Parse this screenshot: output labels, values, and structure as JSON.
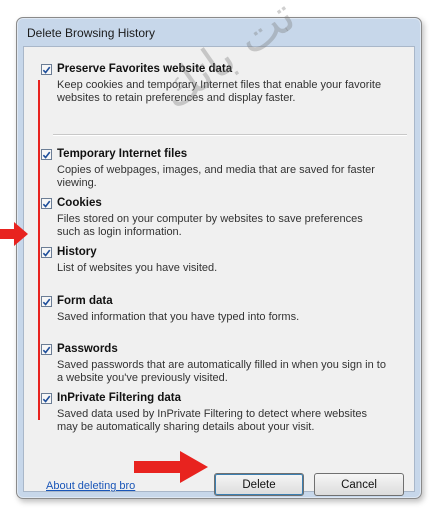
{
  "window": {
    "title": "Delete Browsing History"
  },
  "options": [
    {
      "key": "preserve",
      "label": "Preserve Favorites website data",
      "checked": true,
      "description": "Keep cookies and temporary Internet files that enable your favorite websites to retain preferences and display faster."
    },
    {
      "key": "temp_files",
      "label": "Temporary Internet files",
      "checked": true,
      "description": "Copies of webpages, images, and media that are saved for faster viewing."
    },
    {
      "key": "cookies",
      "label": "Cookies",
      "checked": true,
      "description": "Files stored on your computer by websites to save preferences such as login information."
    },
    {
      "key": "history",
      "label": "History",
      "checked": true,
      "description": "List of websites you have visited."
    },
    {
      "key": "form_data",
      "label": "Form data",
      "checked": true,
      "description": "Saved information that you have typed into forms."
    },
    {
      "key": "passwords",
      "label": "Passwords",
      "checked": true,
      "description": "Saved passwords that are automatically filled in when you sign in to a website you've previously visited."
    },
    {
      "key": "inprivate",
      "label": "InPrivate Filtering data",
      "checked": true,
      "description": "Saved data used by InPrivate Filtering to detect where websites may be automatically sharing details about your visit."
    }
  ],
  "footer": {
    "link_text": "About deleting bro",
    "delete_label": "Delete",
    "cancel_label": "Cancel"
  },
  "watermark": "تت باتك",
  "colors": {
    "annotation_red": "#e8231f",
    "link": "#1a56b8",
    "checkmark": "#1f4f9b"
  }
}
